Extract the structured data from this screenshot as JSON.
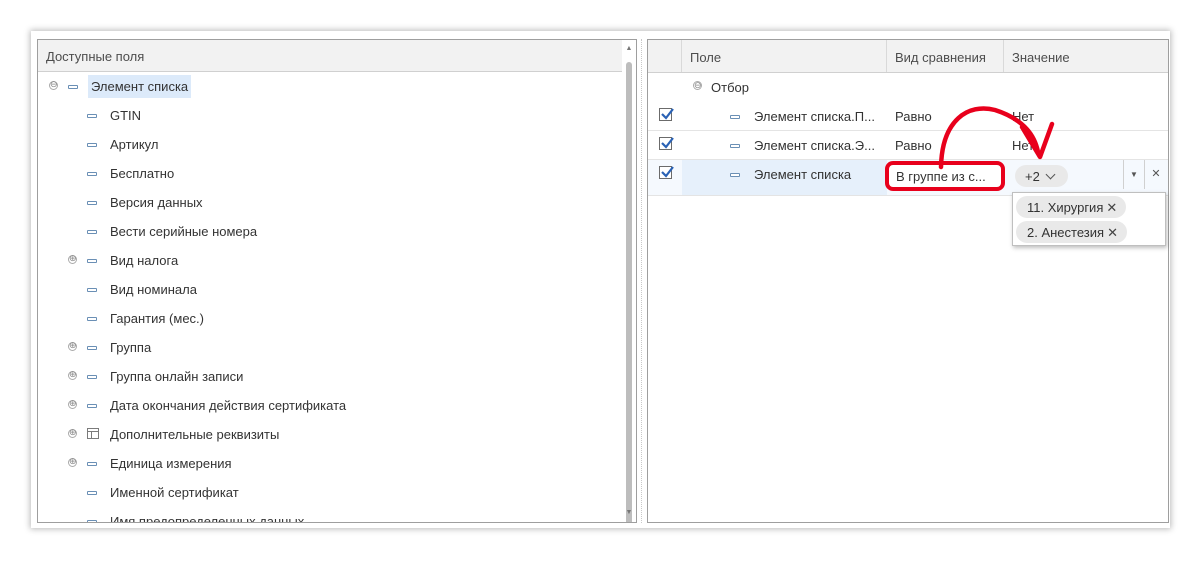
{
  "left_panel": {
    "header": "Доступные поля",
    "items": [
      {
        "label": "Элемент списка",
        "toggle": "⊖",
        "icon": "field-icon",
        "selected": true
      },
      {
        "label": "GTIN",
        "toggle": "",
        "icon": "field-icon"
      },
      {
        "label": "Артикул",
        "toggle": "",
        "icon": "field-icon"
      },
      {
        "label": "Бесплатно",
        "toggle": "",
        "icon": "field-icon"
      },
      {
        "label": "Версия данных",
        "toggle": "",
        "icon": "field-icon"
      },
      {
        "label": "Вести серийные номера",
        "toggle": "",
        "icon": "field-icon"
      },
      {
        "label": "Вид налога",
        "toggle": "⊕",
        "icon": "field-icon"
      },
      {
        "label": "Вид номинала",
        "toggle": "",
        "icon": "field-icon"
      },
      {
        "label": "Гарантия (мес.)",
        "toggle": "",
        "icon": "field-icon"
      },
      {
        "label": "Группа",
        "toggle": "⊕",
        "icon": "field-icon"
      },
      {
        "label": "Группа онлайн записи",
        "toggle": "⊕",
        "icon": "field-icon"
      },
      {
        "label": "Дата окончания действия сертификата",
        "toggle": "⊕",
        "icon": "field-icon"
      },
      {
        "label": "Дополнительные реквизиты",
        "toggle": "⊕",
        "icon": "table-icon"
      },
      {
        "label": "Единица измерения",
        "toggle": "⊕",
        "icon": "field-icon"
      },
      {
        "label": "Именной сертификат",
        "toggle": "",
        "icon": "field-icon"
      },
      {
        "label": "Имя предопределенных данных",
        "toggle": "",
        "icon": "field-icon"
      }
    ]
  },
  "right_panel": {
    "columns": {
      "field": "Поле",
      "comparison": "Вид сравнения",
      "value": "Значение"
    },
    "group_row": {
      "toggle": "⊖",
      "label": "Отбор"
    },
    "rows": [
      {
        "checked": true,
        "field": "Элемент списка.П...",
        "comparison": "Равно",
        "value": "Нет"
      },
      {
        "checked": true,
        "field": "Элемент списка.Э...",
        "comparison": "Равно",
        "value": "Нет"
      },
      {
        "checked": true,
        "field": "Элемент списка",
        "comparison": "В группе из с...",
        "value_chip": "+2"
      }
    ],
    "value_popup": {
      "tags": [
        "11. Хирургия",
        "2. Анестезия"
      ]
    }
  },
  "colors": {
    "annotation": "#e8001c",
    "selection": "#dceafa",
    "header_bg": "#f2f2f2"
  }
}
